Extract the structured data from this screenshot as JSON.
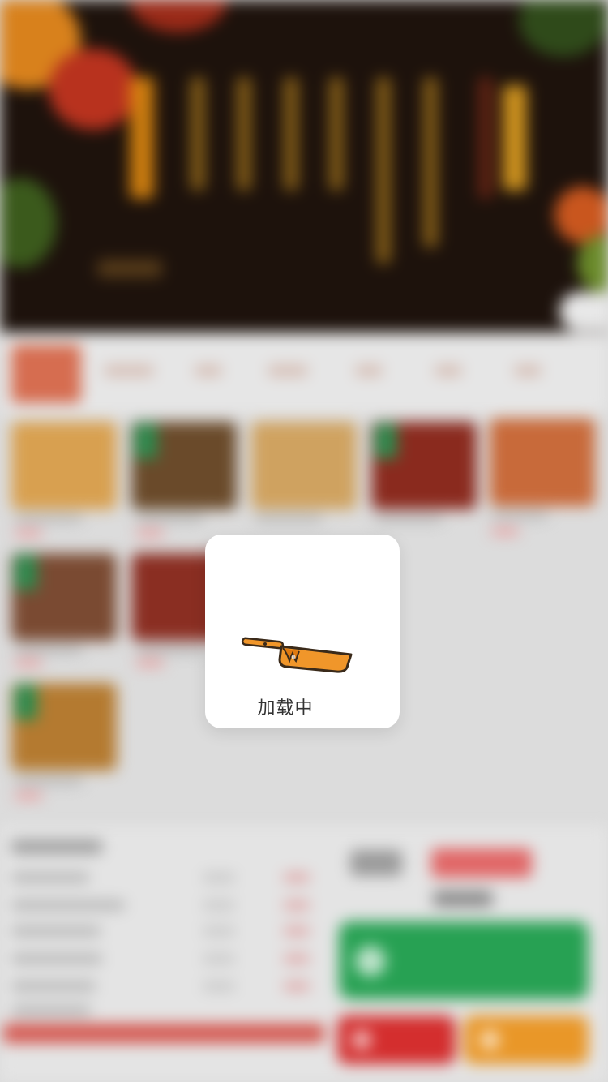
{
  "overlay": {
    "loading_text": "加载中",
    "icon": "frying-pan-icon",
    "accent_color": "#f0962a"
  },
  "background": {
    "state": "blurred",
    "colors": {
      "category_active": "#d66d50",
      "primary_button": "#27a153",
      "secondary_button": "#d42e2e",
      "tertiary_button": "#e99728",
      "price": "#e05050"
    }
  }
}
